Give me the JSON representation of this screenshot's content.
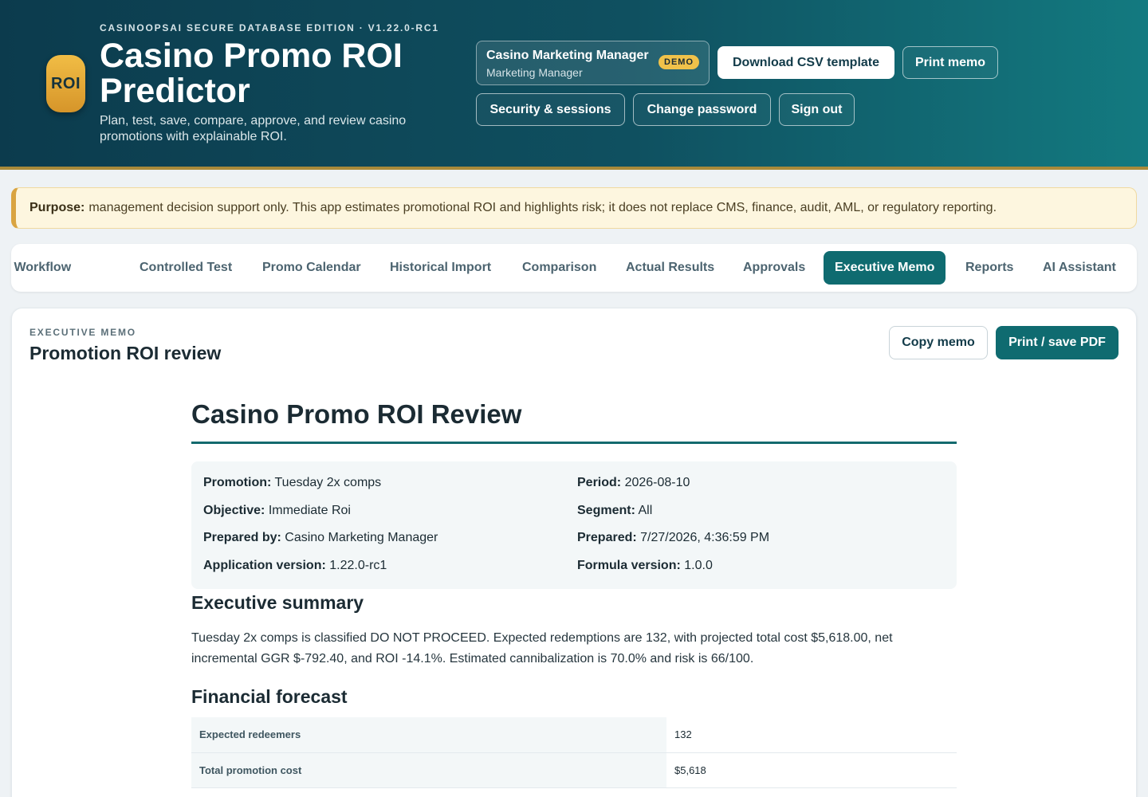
{
  "header": {
    "edition": "CASINOOPSAI SECURE DATABASE EDITION · V1.22.0-RC1",
    "logo_text": "ROI",
    "title": "Casino Promo ROI Predictor",
    "subtitle": "Plan, test, save, compare, approve, and review casino promotions with explainable ROI.",
    "user": {
      "name": "Casino Marketing Manager",
      "role": "Marketing Manager",
      "badge": "DEMO"
    },
    "buttons": {
      "download_csv": "Download CSV template",
      "print_memo": "Print memo",
      "security": "Security & sessions",
      "change_password": "Change password",
      "sign_out": "Sign out"
    }
  },
  "purpose": {
    "label": "Purpose:",
    "text": "management decision support only. This app estimates promotional ROI and highlights risk; it does not replace CMS, finance, audit, AML, or regulatory reporting."
  },
  "tabs": [
    {
      "label": "Promotion Workflow"
    },
    {
      "label": "Controlled Test"
    },
    {
      "label": "Promo Calendar"
    },
    {
      "label": "Historical Import"
    },
    {
      "label": "Comparison"
    },
    {
      "label": "Actual Results"
    },
    {
      "label": "Approvals"
    },
    {
      "label": "Executive Memo",
      "active": true
    },
    {
      "label": "Reports"
    },
    {
      "label": "AI Assistant"
    }
  ],
  "section": {
    "eyebrow": "EXECUTIVE MEMO",
    "title": "Promotion ROI review",
    "copy_button": "Copy memo",
    "print_button": "Print / save PDF"
  },
  "memo": {
    "title": "Casino Promo ROI Review",
    "meta": {
      "promotion": {
        "label": "Promotion:",
        "value": "Tuesday 2x comps"
      },
      "period": {
        "label": "Period:",
        "value": "2026-08-10"
      },
      "objective": {
        "label": "Objective:",
        "value": "Immediate Roi"
      },
      "segment": {
        "label": "Segment:",
        "value": "All"
      },
      "prepared_by": {
        "label": "Prepared by:",
        "value": "Casino Marketing Manager"
      },
      "prepared": {
        "label": "Prepared:",
        "value": "7/27/2026, 4:36:59 PM"
      },
      "app_version": {
        "label": "Application version:",
        "value": "1.22.0-rc1"
      },
      "formula_version": {
        "label": "Formula version:",
        "value": "1.0.0"
      }
    },
    "summary_heading": "Executive summary",
    "summary_text": "Tuesday 2x comps is classified DO NOT PROCEED. Expected redemptions are 132, with projected total cost $5,618.00, net incremental GGR $-792.40, and ROI -14.1%. Estimated cannibalization is 70.0% and risk is 66/100.",
    "forecast_heading": "Financial forecast",
    "forecast_rows": [
      {
        "label": "Expected redeemers",
        "value": "132"
      },
      {
        "label": "Total promotion cost",
        "value": "$5,618"
      }
    ]
  }
}
